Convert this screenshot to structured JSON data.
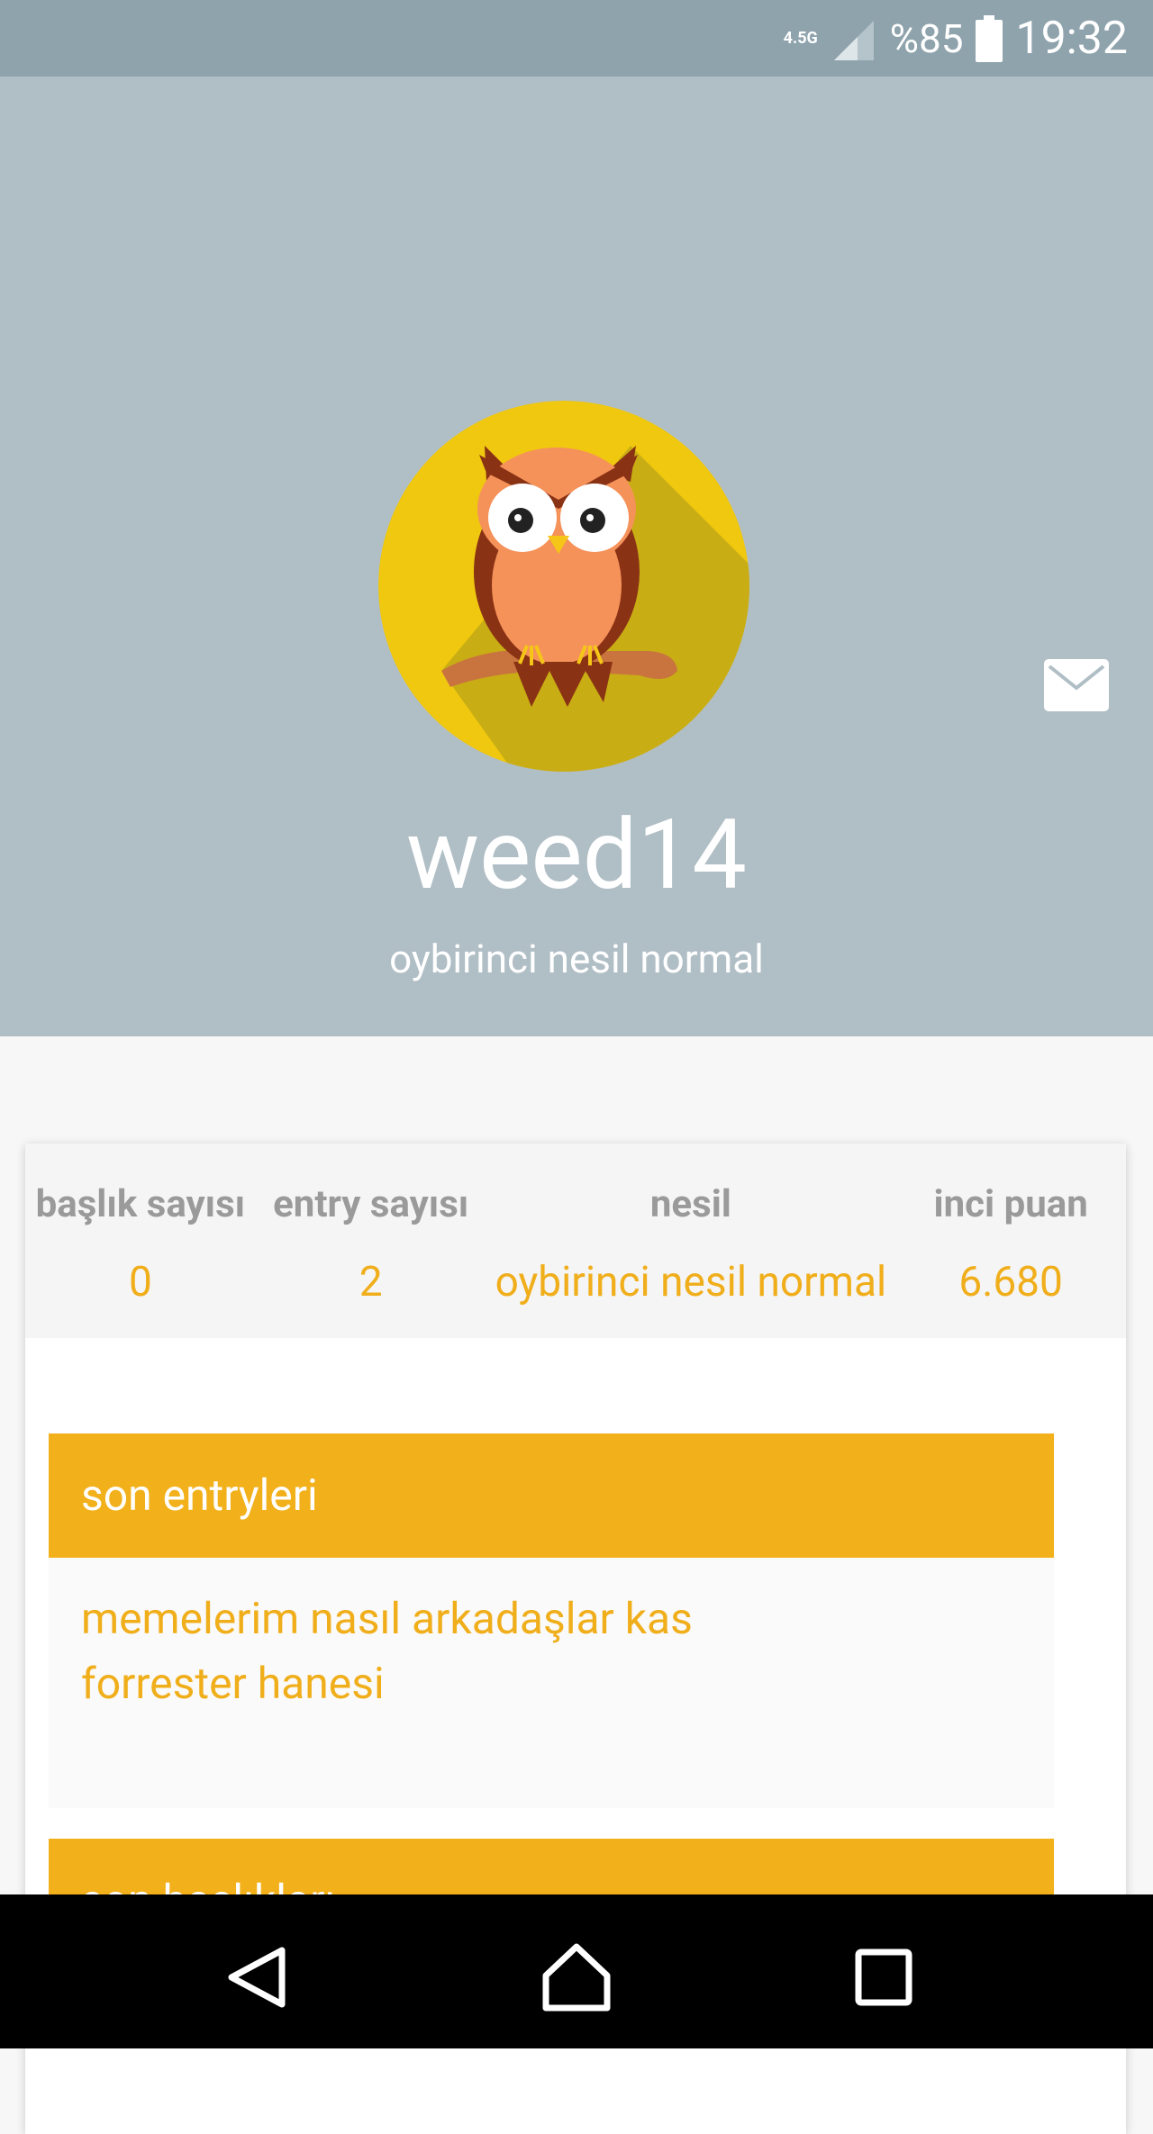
{
  "status_bar": {
    "network": "4.5G",
    "battery": "%85",
    "time": "19:32"
  },
  "profile": {
    "username": "weed14",
    "title": "oybirinci nesil normal",
    "avatar_icon": "owl-avatar",
    "message_icon": "mail-icon"
  },
  "stats": [
    {
      "label": "başlık sayısı",
      "value": "0"
    },
    {
      "label": "entry sayısı",
      "value": "2"
    },
    {
      "label": "nesil",
      "value": "oybirinci nesil normal"
    },
    {
      "label": "inci puan",
      "value": "6.680"
    }
  ],
  "sections": {
    "recent_entries": {
      "title": "son entryleri",
      "items": [
        "memelerim nasıl arkadaşlar kas",
        "forrester hanesi"
      ]
    },
    "next_section_title": "son başlıkları"
  },
  "colors": {
    "accent": "#f2b01a",
    "header_bg": "#b0bec5",
    "status_bg": "#8fa3ad"
  },
  "nav_bar": {
    "back_icon": "back-icon",
    "home_icon": "home-icon",
    "recents_icon": "recents-icon"
  }
}
